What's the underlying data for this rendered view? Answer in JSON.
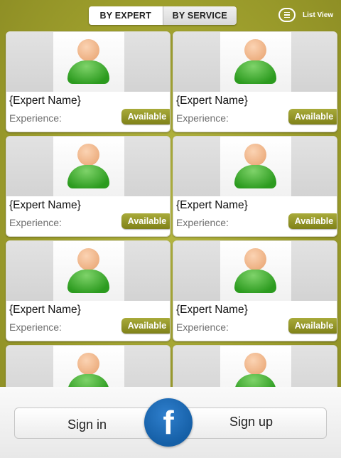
{
  "top_bar": {
    "segments": [
      {
        "label": "BY EXPERT",
        "active": true
      },
      {
        "label": "BY SERVICE",
        "active": false
      }
    ],
    "list_view_label": "List View",
    "list_view_icon": "list-icon"
  },
  "experts": [
    {
      "name": "{Expert Name}",
      "experience_label": "Experience:",
      "status": "Available"
    },
    {
      "name": "{Expert Name}",
      "experience_label": "Experience:",
      "status": "Available"
    },
    {
      "name": "{Expert Name}",
      "experience_label": "Experience:",
      "status": "Available"
    },
    {
      "name": "{Expert Name}",
      "experience_label": "Experience:",
      "status": "Available"
    },
    {
      "name": "{Expert Name}",
      "experience_label": "Experience:",
      "status": "Available"
    },
    {
      "name": "{Expert Name}",
      "experience_label": "Experience:",
      "status": "Available"
    },
    {
      "name": "",
      "experience_label": "",
      "status": ""
    },
    {
      "name": "",
      "experience_label": "",
      "status": ""
    }
  ],
  "bottom_bar": {
    "sign_in_label": "Sign in",
    "sign_up_label": "Sign up",
    "facebook_glyph": "f",
    "facebook_icon": "facebook-icon"
  },
  "colors": {
    "background": "#9e9f2d",
    "badge": "#8f9124",
    "avatar_body": "#2c9b1f",
    "facebook_blue": "#155fa6"
  }
}
